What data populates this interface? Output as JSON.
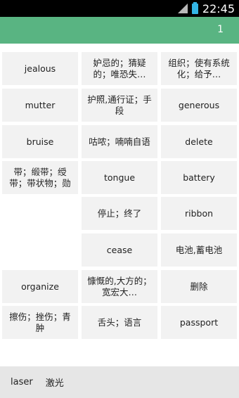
{
  "status_bar": {
    "time": "22:45",
    "icons": [
      "signal-icon",
      "battery-icon"
    ],
    "battery_color": "#33b5e5"
  },
  "app_bar": {
    "counter": "1",
    "color": "#59b482"
  },
  "cards": [
    "jealous",
    "妒忌的；猜疑的；唯恐失…",
    "组织；使有系统化；给予…",
    "mutter",
    "护照,通行证；手段",
    "generous",
    "bruise",
    "咕哝；喃喃自语",
    "delete",
    "带；缎带；绶带；带状物；勋",
    "tongue",
    "battery",
    "停止；终了",
    "ribbon",
    "cease",
    "电池,蓄电池",
    "organize",
    "慷慨的,大方的；宽宏大…",
    "删除",
    "擦伤；挫伤；青肿",
    "舌头；语言",
    "passport"
  ],
  "bottom_bar": {
    "word": "laser",
    "meaning": "激光"
  }
}
